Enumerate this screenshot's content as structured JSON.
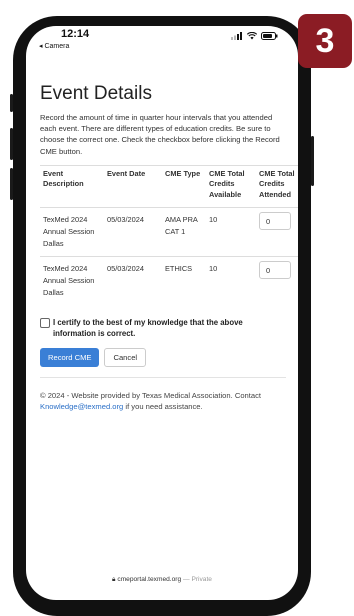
{
  "badge": {
    "number": "3",
    "color": "#8b1c24"
  },
  "status_bar": {
    "time": "12:14",
    "back_label": "◂ Camera",
    "icons": [
      "signal-icon",
      "wifi-icon",
      "battery-icon"
    ]
  },
  "page": {
    "title": "Event Details",
    "intro": "Record the amount of time in quarter hour intervals that you attended each event. There are different types of education credits. Be sure to choose the correct one. Check the checkbox before clicking the Record CME button."
  },
  "table": {
    "headers": [
      "Event Description",
      "Event Date",
      "CME Type",
      "CME Total Credits Available",
      "CME Total Credits Attended"
    ],
    "rows": [
      {
        "description": "TexMed 2024 Annual Session Dallas",
        "date": "05/03/2024",
        "type": "AMA PRA CAT 1",
        "available": "10",
        "attended": "0"
      },
      {
        "description": "TexMed 2024 Annual Session Dallas",
        "date": "05/03/2024",
        "type": "ETHICS",
        "available": "10",
        "attended": "0"
      }
    ]
  },
  "certify_label": "I certify to the best of my knowledge that the above information is correct.",
  "buttons": {
    "record": "Record CME",
    "cancel": "Cancel",
    "primary_color": "#3a7fd6"
  },
  "footer": {
    "prefix": "© 2024 - Website provided by Texas Medical Association. Contact ",
    "email": "Knowledge@texmed.org",
    "suffix": " if you need assistance."
  },
  "url_bar": {
    "lock_icon": "lock-icon",
    "domain": "cmeportal.texmed.org",
    "private": "— Private"
  }
}
